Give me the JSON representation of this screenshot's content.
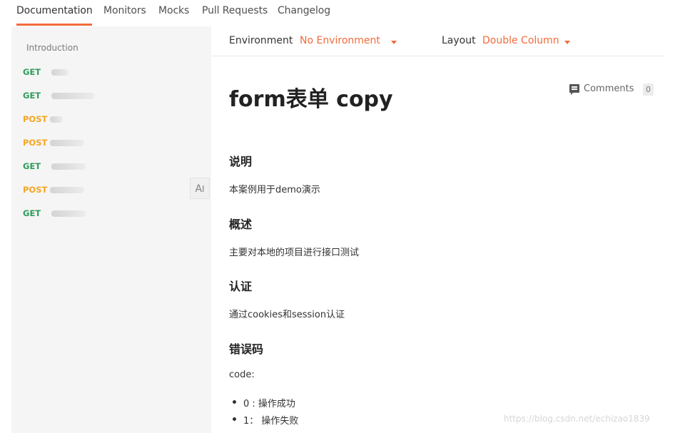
{
  "tabs": [
    {
      "label": "Documentation",
      "active": true
    },
    {
      "label": "Monitors"
    },
    {
      "label": "Mocks"
    },
    {
      "label": "Pull Requests"
    },
    {
      "label": "Changelog"
    }
  ],
  "sidebar": {
    "introduction_label": "Introduction",
    "requests": [
      {
        "method": "GET"
      },
      {
        "method": "GET"
      },
      {
        "method": "POST"
      },
      {
        "method": "POST"
      },
      {
        "method": "GET"
      },
      {
        "method": "POST"
      },
      {
        "method": "GET"
      }
    ],
    "font_size_button_label": "A"
  },
  "env_bar": {
    "environment_label": "Environment",
    "environment_value": "No Environment",
    "layout_label": "Layout",
    "layout_value": "Double Column"
  },
  "doc": {
    "title": "form表单 copy",
    "comments_label": "Comments",
    "comments_count": "0",
    "sections": [
      {
        "heading": "说明",
        "body": "本案例用于demo演示"
      },
      {
        "heading": "概述",
        "body": "主要对本地的项目进行接口测试"
      },
      {
        "heading": "认证",
        "body": "通过cookies和session认证"
      },
      {
        "heading": "错误码",
        "body": "code:"
      }
    ],
    "error_codes": [
      "0 : 操作成功",
      "1： 操作失败"
    ]
  },
  "watermark": "https://blog.csdn.net/echizao1839",
  "colors": {
    "accent": "#f26b3a",
    "get": "#2e9c5c",
    "post": "#f5a623",
    "sidebar_bg": "#f5f5f5"
  }
}
